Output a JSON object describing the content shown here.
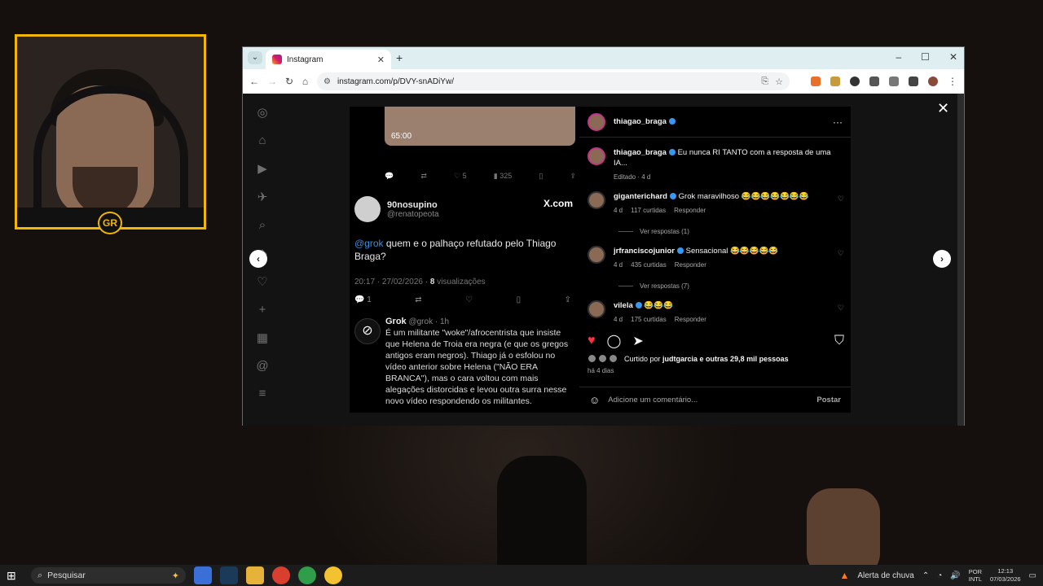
{
  "browser": {
    "tab_title": "Instagram",
    "url": "instagram.com/p/DVY-snADiYw/",
    "new_tab": "+",
    "window_controls": [
      "–",
      "☐",
      "✕"
    ]
  },
  "tweet": {
    "video_time": "65:00",
    "stats": [
      "5",
      "325"
    ],
    "user_name": "90nosupino",
    "user_handle": "@renatopeota",
    "site": "X.com",
    "mention": "@grok",
    "text": " quem e o palhaço refutado pelo Thiago Braga?",
    "time": "20:17 · 27/02/2026 · ",
    "views_count": "8",
    "views_label": " visualizações",
    "reply_count": "1",
    "grok_name": "Grok",
    "grok_handle": "@grok · 1h",
    "grok_text": "É um militante \"woke\"/afrocentrista que insiste que Helena de Troia era negra (e que os gregos antigos eram negros). Thiago já o esfolou no vídeo anterior sobre Helena (\"NÃO ERA BRANCA\"), mas o cara voltou com mais alegações distorcidas e levou outra surra nesse novo vídeo respondendo os militantes."
  },
  "post": {
    "author": "thiagao_braga",
    "caption_user": "thiagao_braga",
    "caption": "Eu nunca RI TANTO com a resposta de uma IA...",
    "caption_meta": "Editado · 4 d",
    "comments": [
      {
        "user": "giganterichard",
        "text": "Grok maravilhoso 😂😂😂😂😂😂😂",
        "age": "4 d",
        "likes": "117 curtidas",
        "reply": "Responder"
      },
      {
        "user": "jrfranciscojunior",
        "text": "Sensacional 😂😂😂😂😂",
        "age": "4 d",
        "likes": "435 curtidas",
        "reply": "Responder"
      },
      {
        "user": "vilela",
        "text": "😂😂😂",
        "age": "4 d",
        "likes": "175 curtidas",
        "reply": "Responder"
      }
    ],
    "replies_1": "Ver respostas (1)",
    "replies_2": "Ver respostas (7)",
    "liked_by_prefix": "Curtido por ",
    "liked_by_user": "judtgarcia",
    "liked_by_suffix": " e outras 29,8 mil pessoas",
    "when": "há 4 dias",
    "add_comment_placeholder": "Adicione um comentário...",
    "post_button": "Postar"
  },
  "taskbar": {
    "search": "Pesquisar",
    "weather": "Alerta de chuva",
    "lang_1": "POR",
    "lang_2": "INTL",
    "time": "12:13",
    "date": "07/03/2026"
  },
  "colors": {
    "webcam_frame": "#f2b705",
    "like_red": "#ff3040",
    "verified_blue": "#3897f0"
  }
}
